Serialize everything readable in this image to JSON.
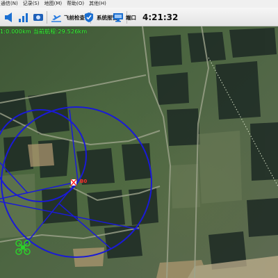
{
  "menu": {
    "items": [
      "通信(N)",
      "记录(S)",
      "地图(M)",
      "帮助(O)",
      "其他(H)"
    ]
  },
  "toolbar": {
    "flight_check_label": "飞前检查",
    "system_alarm_label": "系统报警",
    "port_label": "端口",
    "clock": "4:21:32"
  },
  "map": {
    "status_text": "1:0.000km 当前航程:29.526km",
    "target_label": "B0"
  },
  "colors": {
    "status_green": "#3cff3c",
    "circle_blue": "#1a1ad6",
    "target_red": "#ff2a2a",
    "drone_green": "#2bd22b"
  },
  "icons": [
    "speaker-icon",
    "volume-bars-icon",
    "record-icon",
    "takeoff-icon",
    "shield-check-icon",
    "monitor-icon"
  ]
}
